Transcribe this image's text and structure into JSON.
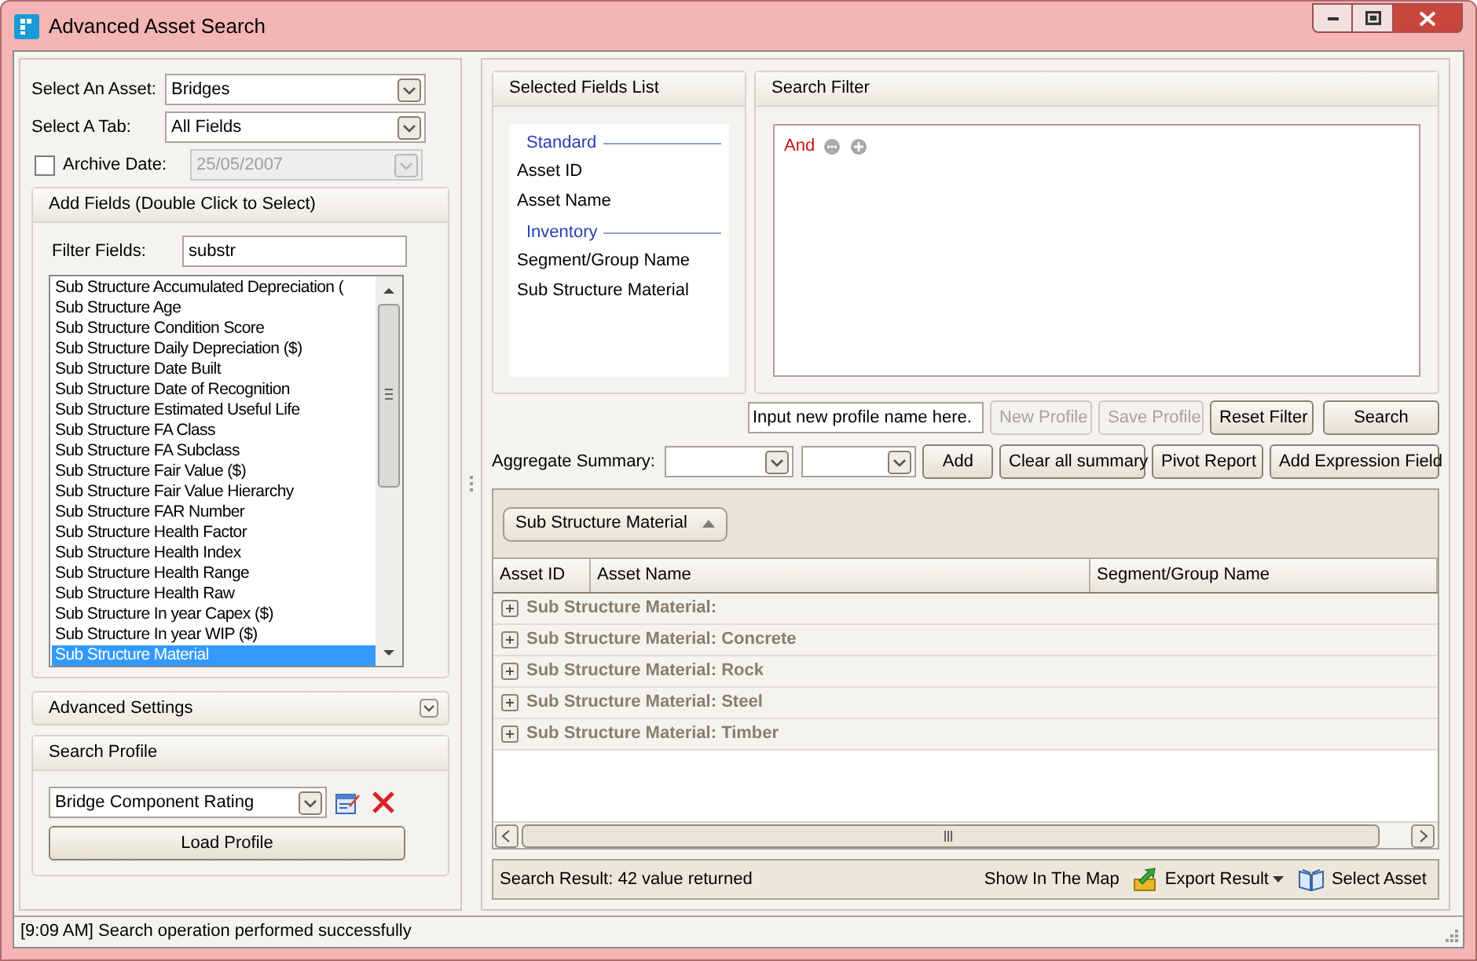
{
  "window": {
    "title": "Advanced Asset Search"
  },
  "asset_select": {
    "label": "Select An Asset:",
    "value": "Bridges"
  },
  "tab_select": {
    "label": "Select A Tab:",
    "value": "All Fields"
  },
  "archive_date": {
    "label": "Archive Date:",
    "checked": false,
    "value": "25/05/2007",
    "disabled": true
  },
  "add_fields": {
    "title": "Add Fields (Double Click to Select)",
    "filter_label": "Filter Fields:",
    "filter_value": "substr",
    "fields": [
      {
        "label": "Sub Structure Accumulated Depreciation (",
        "selected": false
      },
      {
        "label": "Sub Structure Age",
        "selected": false
      },
      {
        "label": "Sub Structure Condition Score",
        "selected": false
      },
      {
        "label": "Sub Structure Daily Depreciation ($)",
        "selected": false
      },
      {
        "label": "Sub Structure Date Built",
        "selected": false
      },
      {
        "label": "Sub Structure Date of Recognition",
        "selected": false
      },
      {
        "label": "Sub Structure Estimated Useful Life",
        "selected": false
      },
      {
        "label": "Sub Structure FA Class",
        "selected": false
      },
      {
        "label": "Sub Structure FA Subclass",
        "selected": false
      },
      {
        "label": "Sub Structure Fair Value ($)",
        "selected": false
      },
      {
        "label": "Sub Structure Fair Value Hierarchy",
        "selected": false
      },
      {
        "label": "Sub Structure FAR Number",
        "selected": false
      },
      {
        "label": "Sub Structure Health Factor",
        "selected": false
      },
      {
        "label": "Sub Structure Health Index",
        "selected": false
      },
      {
        "label": "Sub Structure Health Range",
        "selected": false
      },
      {
        "label": "Sub Structure Health Raw",
        "selected": false
      },
      {
        "label": "Sub Structure In year Capex ($)",
        "selected": false
      },
      {
        "label": "Sub Structure In year WIP ($)",
        "selected": false
      },
      {
        "label": "Sub Structure Material",
        "selected": true
      }
    ]
  },
  "advanced_settings": {
    "title": "Advanced Settings",
    "expanded": false
  },
  "search_profile": {
    "title": "Search Profile",
    "value": "Bridge Component Rating",
    "button": "Load Profile"
  },
  "selected_fields": {
    "title": "Selected Fields List",
    "groups": [
      {
        "name": "Standard",
        "items": [
          "Asset ID",
          "Asset Name"
        ]
      },
      {
        "name": "Inventory",
        "items": [
          "Segment/Group Name",
          "Sub Structure Material"
        ]
      }
    ]
  },
  "search_filter": {
    "title": "Search Filter",
    "operator": "And"
  },
  "profile_name": {
    "value": "Input new profile name here."
  },
  "profile_buttons": [
    {
      "label": "New Profile",
      "disabled": true
    },
    {
      "label": "Save Profile",
      "disabled": true
    },
    {
      "label": "Reset Filter",
      "disabled": false
    },
    {
      "label": "Search",
      "disabled": false
    }
  ],
  "aggregate": {
    "label": "Aggregate Summary:",
    "buttons": [
      "Add",
      "Clear all summary",
      "Pivot Report",
      "Add Expression Field"
    ]
  },
  "group_chip": {
    "label": "Sub Structure Material"
  },
  "table": {
    "columns": [
      "Asset ID",
      "Asset Name",
      "Segment/Group Name"
    ],
    "groups": [
      {
        "label": "Sub Structure Material:",
        "expanded": false
      },
      {
        "label": "Sub Structure Material: Concrete",
        "expanded": false
      },
      {
        "label": "Sub Structure Material: Rock",
        "expanded": false
      },
      {
        "label": "Sub Structure Material: Steel",
        "expanded": false
      },
      {
        "label": "Sub Structure Material: Timber",
        "expanded": false
      }
    ]
  },
  "result_bar": {
    "text": "Search Result: 42 value returned",
    "actions": [
      {
        "kind": "map",
        "label": "Show In The Map"
      },
      {
        "kind": "export",
        "label": "Export Result"
      },
      {
        "kind": "select",
        "label": "Select Asset"
      }
    ]
  },
  "status_bar": "[9:09 AM] Search operation performed successfully"
}
